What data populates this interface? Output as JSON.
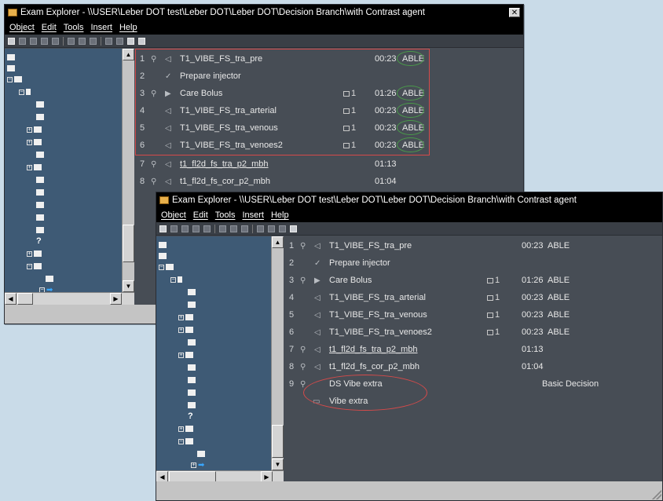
{
  "windows": [
    {
      "title": "Exam Explorer - \\\\USER\\Leber DOT test\\Leber DOT\\Leber DOT\\Decision Branch\\with Contrast agent",
      "close_glyph": "✕",
      "menu": [
        "Object",
        "Edit",
        "Tools",
        "Insert",
        "Help"
      ],
      "rows": [
        {
          "num": "1",
          "ic1": "⚲",
          "ic2": "◁",
          "name": "T1_VIBE_FS_tra_pre",
          "cnt": "",
          "time": "00:23",
          "status": "ABLE",
          "link": false
        },
        {
          "num": "2",
          "ic1": "",
          "ic2": "✓",
          "name": "Prepare injector",
          "cnt": "",
          "time": "",
          "status": "",
          "link": false
        },
        {
          "num": "3",
          "ic1": "⚲",
          "ic2": "▶",
          "name": "Care Bolus",
          "cnt": "1",
          "time": "01:26",
          "status": "ABLE",
          "link": false
        },
        {
          "num": "4",
          "ic1": "",
          "ic2": "◁",
          "name": "T1_VIBE_FS_tra_arterial",
          "cnt": "1",
          "time": "00:23",
          "status": "ABLE",
          "link": false
        },
        {
          "num": "5",
          "ic1": "",
          "ic2": "◁",
          "name": "T1_VIBE_FS_tra_venous",
          "cnt": "1",
          "time": "00:23",
          "status": "ABLE",
          "link": false
        },
        {
          "num": "6",
          "ic1": "",
          "ic2": "◁",
          "name": "T1_VIBE_FS_tra_venoes2",
          "cnt": "1",
          "time": "00:23",
          "status": "ABLE",
          "link": false
        },
        {
          "num": "7",
          "ic1": "⚲",
          "ic2": "◁",
          "name": "t1_fl2d_fs_tra_p2_mbh",
          "cnt": "",
          "time": "01:13",
          "status": "",
          "link": true
        },
        {
          "num": "8",
          "ic1": "⚲",
          "ic2": "◁",
          "name": "t1_fl2d_fs_cor_p2_mbh",
          "cnt": "",
          "time": "01:04",
          "status": "",
          "link": false
        }
      ]
    },
    {
      "title": "Exam Explorer - \\\\USER\\Leber DOT test\\Leber DOT\\Leber DOT\\Decision Branch\\with Contrast agent",
      "close_glyph": "✕",
      "menu": [
        "Object",
        "Edit",
        "Tools",
        "Insert",
        "Help"
      ],
      "rows": [
        {
          "num": "1",
          "ic1": "⚲",
          "ic2": "◁",
          "name": "T1_VIBE_FS_tra_pre",
          "cnt": "",
          "time": "00:23",
          "status": "ABLE",
          "link": false
        },
        {
          "num": "2",
          "ic1": "",
          "ic2": "✓",
          "name": "Prepare injector",
          "cnt": "",
          "time": "",
          "status": "",
          "link": false
        },
        {
          "num": "3",
          "ic1": "⚲",
          "ic2": "▶",
          "name": "Care Bolus",
          "cnt": "1",
          "time": "01:26",
          "status": "ABLE",
          "link": false
        },
        {
          "num": "4",
          "ic1": "",
          "ic2": "◁",
          "name": "T1_VIBE_FS_tra_arterial",
          "cnt": "1",
          "time": "00:23",
          "status": "ABLE",
          "link": false
        },
        {
          "num": "5",
          "ic1": "",
          "ic2": "◁",
          "name": "T1_VIBE_FS_tra_venous",
          "cnt": "1",
          "time": "00:23",
          "status": "ABLE",
          "link": false
        },
        {
          "num": "6",
          "ic1": "",
          "ic2": "◁",
          "name": "T1_VIBE_FS_tra_venoes2",
          "cnt": "1",
          "time": "00:23",
          "status": "ABLE",
          "link": false
        },
        {
          "num": "7",
          "ic1": "⚲",
          "ic2": "◁",
          "name": "t1_fl2d_fs_tra_p2_mbh",
          "cnt": "",
          "time": "01:13",
          "status": "",
          "link": true
        },
        {
          "num": "8",
          "ic1": "⚲",
          "ic2": "◁",
          "name": "t1_fl2d_fs_cor_p2_mbh",
          "cnt": "",
          "time": "01:04",
          "status": "",
          "link": false
        },
        {
          "num": "9",
          "ic1": "⚲",
          "ic2": "",
          "name": "DS Vibe extra",
          "cnt": "",
          "time": "",
          "status": "Basic Decision",
          "link": false
        },
        {
          "num": "",
          "ic1": "",
          "ic2": "▭",
          "name": "Vibe extra",
          "cnt": "",
          "time": "",
          "status": "",
          "link": false
        }
      ]
    }
  ],
  "colors": {
    "background": "#c9dbe8",
    "tree": "#3e5a75",
    "list": "#474d55",
    "highlight_red": "#d64a4a",
    "highlight_green": "#4a9a4a"
  }
}
